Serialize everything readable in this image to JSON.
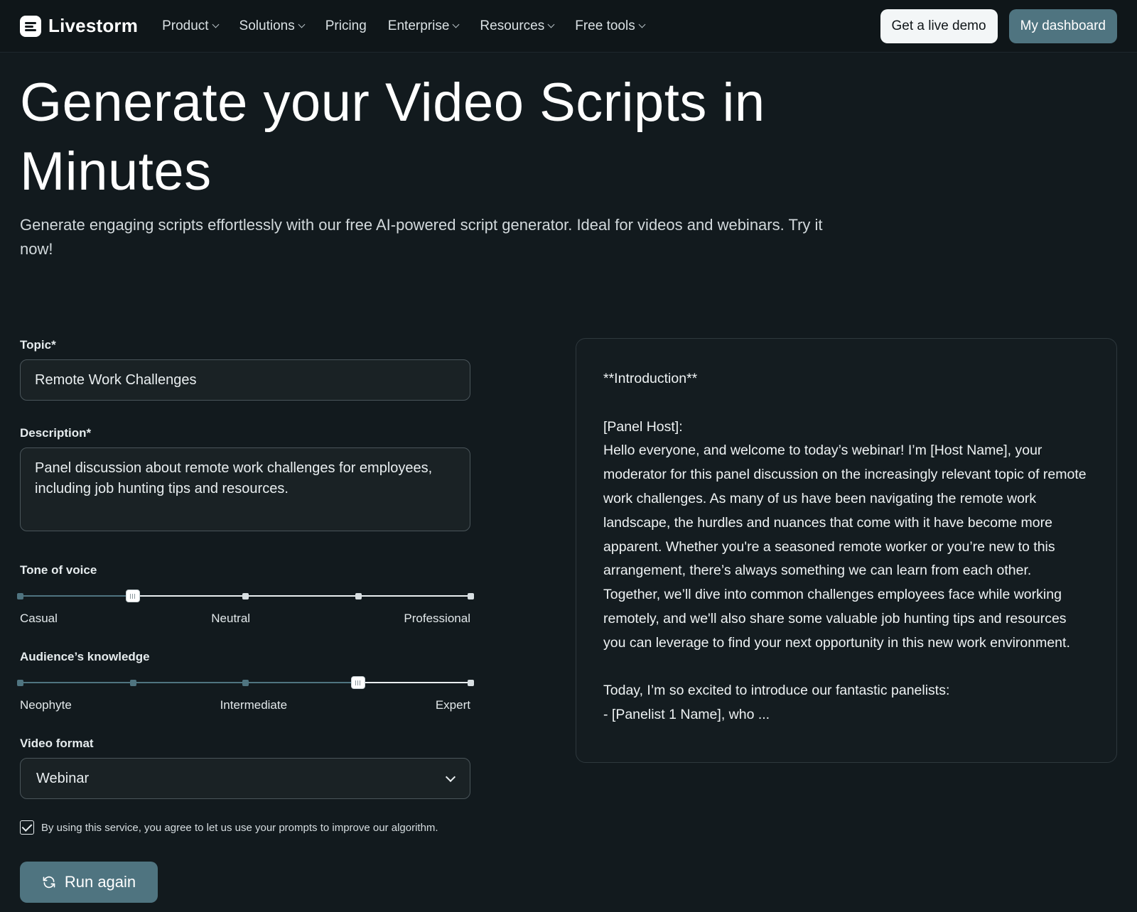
{
  "nav": {
    "brand": "Livestorm",
    "links": [
      {
        "label": "Product",
        "dropdown": true
      },
      {
        "label": "Solutions",
        "dropdown": true
      },
      {
        "label": "Pricing",
        "dropdown": false
      },
      {
        "label": "Enterprise",
        "dropdown": true
      },
      {
        "label": "Resources",
        "dropdown": true
      },
      {
        "label": "Free tools",
        "dropdown": true
      }
    ],
    "demo_label": "Get a live demo",
    "dashboard_label": "My dashboard"
  },
  "hero": {
    "title": "Generate your Video Scripts in Minutes",
    "subtitle": "Generate engaging scripts effortlessly with our free AI-powered script generator. Ideal for videos and webinars. Try it now!"
  },
  "form": {
    "topic_label": "Topic*",
    "topic_value": "Remote Work Challenges",
    "description_label": "Description*",
    "description_value": "Panel discussion about remote work challenges for employees, including job hunting tips and resources.",
    "tone": {
      "label": "Tone of voice",
      "left": "Casual",
      "middle": "Neutral",
      "right": "Professional",
      "steps": 5,
      "selected_index": 1
    },
    "audience": {
      "label": "Audience’s knowledge",
      "left": "Neophyte",
      "middle": "Intermediate",
      "right": "Expert",
      "steps": 5,
      "selected_index": 3
    },
    "format_label": "Video format",
    "format_value": "Webinar",
    "consent_text": "By using this service, you agree to let us use your prompts to improve our algorithm.",
    "consent_checked": true,
    "run_label": "Run again"
  },
  "output": {
    "text": "**Introduction**\n\n[Panel Host]:\nHello everyone, and welcome to today’s webinar! I’m [Host Name], your moderator for this panel discussion on the increasingly relevant topic of remote work challenges. As many of us have been navigating the remote work landscape, the hurdles and nuances that come with it have become more apparent. Whether you're a seasoned remote worker or you’re new to this arrangement, there’s always something we can learn from each other. Together, we’ll dive into common challenges employees face while working remotely, and we'll also share some valuable job hunting tips and resources you can leverage to find your next opportunity in this new work environment.\n\nToday, I’m so excited to introduce our fantastic panelists:\n- [Panelist 1 Name], who ..."
  },
  "colors": {
    "background": "#121a1e",
    "accent": "#4f7480",
    "nav_bg": "#0f1619"
  }
}
